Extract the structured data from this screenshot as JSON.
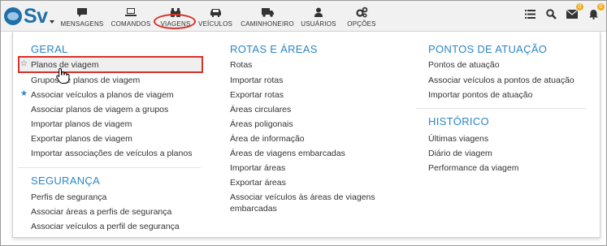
{
  "brand": {
    "text": "Sv",
    "color": "#1f6fa9"
  },
  "nav": {
    "items": [
      {
        "label": "MENSAGENS",
        "icon": "comment-icon"
      },
      {
        "label": "COMANDOS",
        "icon": "laptop-icon"
      },
      {
        "label": "VIAGENS",
        "icon": "binoculars-icon"
      },
      {
        "label": "VEÍCULOS",
        "icon": "car-icon"
      },
      {
        "label": "CAMINHONEIRO",
        "icon": "truck-icon"
      },
      {
        "label": "USUÁRIOS",
        "icon": "user-icon"
      },
      {
        "label": "OPÇÕES",
        "icon": "cogs-icon"
      }
    ],
    "right_icons": [
      {
        "icon": "list-icon"
      },
      {
        "icon": "search-icon"
      },
      {
        "icon": "envelope-icon",
        "badge": "0"
      },
      {
        "icon": "bell-icon",
        "badge": "0"
      }
    ]
  },
  "accent": "#2b86c5",
  "highlight_color": "#d6322a",
  "menu": {
    "geral": {
      "title": "GERAL",
      "items": [
        "Planos de viagem",
        "Grupos de planos de viagem",
        "Associar veículos a planos de viagem",
        "Associar planos de viagem a grupos",
        "Importar planos de viagem",
        "Exportar planos de viagem",
        "Importar associações de veículos a planos"
      ]
    },
    "seguranca": {
      "title": "SEGURANÇA",
      "items": [
        "Perfis de segurança",
        "Associar áreas a perfis de segurança",
        "Associar veículos a perfil de segurança"
      ]
    },
    "rotas": {
      "title": "ROTAS E ÁREAS",
      "items": [
        "Rotas",
        "Importar rotas",
        "Exportar rotas",
        "Áreas circulares",
        "Áreas poligonais",
        "Área de informação",
        "Áreas de viagens embarcadas",
        "Importar áreas",
        "Exportar áreas",
        "Associar veículos às áreas de viagens embarcadas"
      ]
    },
    "pontos": {
      "title": "PONTOS DE ATUAÇÃO",
      "items": [
        "Pontos de atuação",
        "Associar veículos a pontos de atuação",
        "Importar pontos de atuação"
      ]
    },
    "historico": {
      "title": "HISTÓRICO",
      "items": [
        "Últimas viagens",
        "Diário de viagem",
        "Performance da viagem"
      ]
    }
  }
}
